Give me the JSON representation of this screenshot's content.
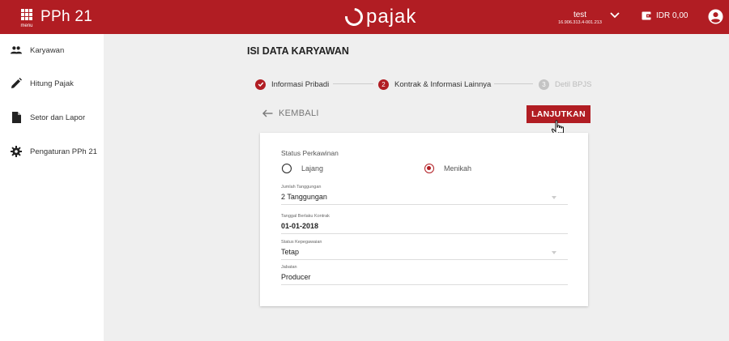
{
  "header": {
    "menu_label": "menu",
    "app_title": "PPh 21",
    "logo_text": "pajak",
    "user_name": "test",
    "user_npwp": "16.906.313.4-001.213",
    "balance": "IDR 0,00"
  },
  "sidebar": {
    "items": [
      {
        "label": "Karyawan",
        "icon": "people-icon"
      },
      {
        "label": "Hitung Pajak",
        "icon": "pencil-icon"
      },
      {
        "label": "Setor dan Lapor",
        "icon": "document-icon"
      },
      {
        "label": "Pengaturan PPh 21",
        "icon": "gear-icon"
      }
    ]
  },
  "main": {
    "title": "ISI DATA KARYAWAN",
    "steps": [
      {
        "number": "1",
        "label": "Informasi Pribadi",
        "state": "done"
      },
      {
        "number": "2",
        "label": "Kontrak & Informasi Lainnya",
        "state": "active"
      },
      {
        "number": "3",
        "label": "Detil BPJS",
        "state": "inactive"
      }
    ],
    "back_label": "KEMBALI",
    "next_label": "LANJUTKAN"
  },
  "form": {
    "marital_status_label": "Status Perkawinan",
    "marital_options": [
      {
        "label": "Lajang",
        "checked": false
      },
      {
        "label": "Menikah",
        "checked": true
      }
    ],
    "dependents": {
      "label": "Jumlah Tanggungan",
      "value": "2 Tanggungan"
    },
    "contract_date": {
      "label": "Tanggal Berlaku Kontrak",
      "value": "01-01-2018"
    },
    "employment_status": {
      "label": "Status Kepegawaian",
      "value": "Tetap"
    },
    "position": {
      "label": "Jabatan",
      "value": "Producer"
    }
  },
  "colors": {
    "brand": "#b11d23",
    "background": "#efefef"
  }
}
